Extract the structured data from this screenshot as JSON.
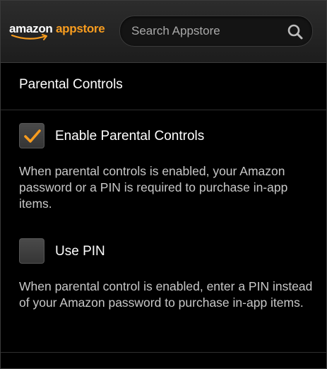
{
  "header": {
    "logo": {
      "amazon": "amazon",
      "appstore": "appstore"
    },
    "search": {
      "placeholder": "Search Appstore",
      "icon": "search-icon"
    }
  },
  "page": {
    "title": "Parental Controls"
  },
  "options": [
    {
      "label": "Enable Parental Controls",
      "checked": true,
      "description": "When parental controls is enabled, your Amazon password or a PIN is required to purchase in-app items."
    },
    {
      "label": "Use PIN",
      "checked": false,
      "description": "When parental control is enabled, enter a PIN instead of your Amazon password to purchase in-app items."
    }
  ],
  "colors": {
    "accent": "#f79c1f",
    "background": "#000000",
    "header": "#262626",
    "text": "#ffffff",
    "secondary_text": "#c8c8c8"
  }
}
